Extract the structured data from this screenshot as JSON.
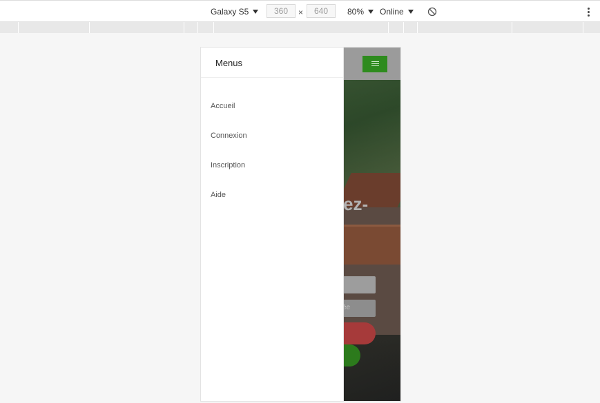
{
  "devtools": {
    "device": "Galaxy S5",
    "width": "360",
    "times": "×",
    "height": "640",
    "zoom": "80%",
    "network": "Online",
    "icons": [
      "caret-down-icon",
      "rotate-icon",
      "more-vertical-icon"
    ]
  },
  "drawer": {
    "title": "Menus",
    "items": [
      {
        "label": "Accueil"
      },
      {
        "label": "Connexion"
      },
      {
        "label": "Inscription"
      },
      {
        "label": "Aide"
      }
    ]
  },
  "hero": {
    "heading_fragment": "ez-",
    "date_placeholder_fragment": "ée"
  },
  "colors": {
    "accent_green": "#2e8b1e",
    "cta_red": "#a63a3a",
    "cta_green": "#2c7a1c"
  }
}
